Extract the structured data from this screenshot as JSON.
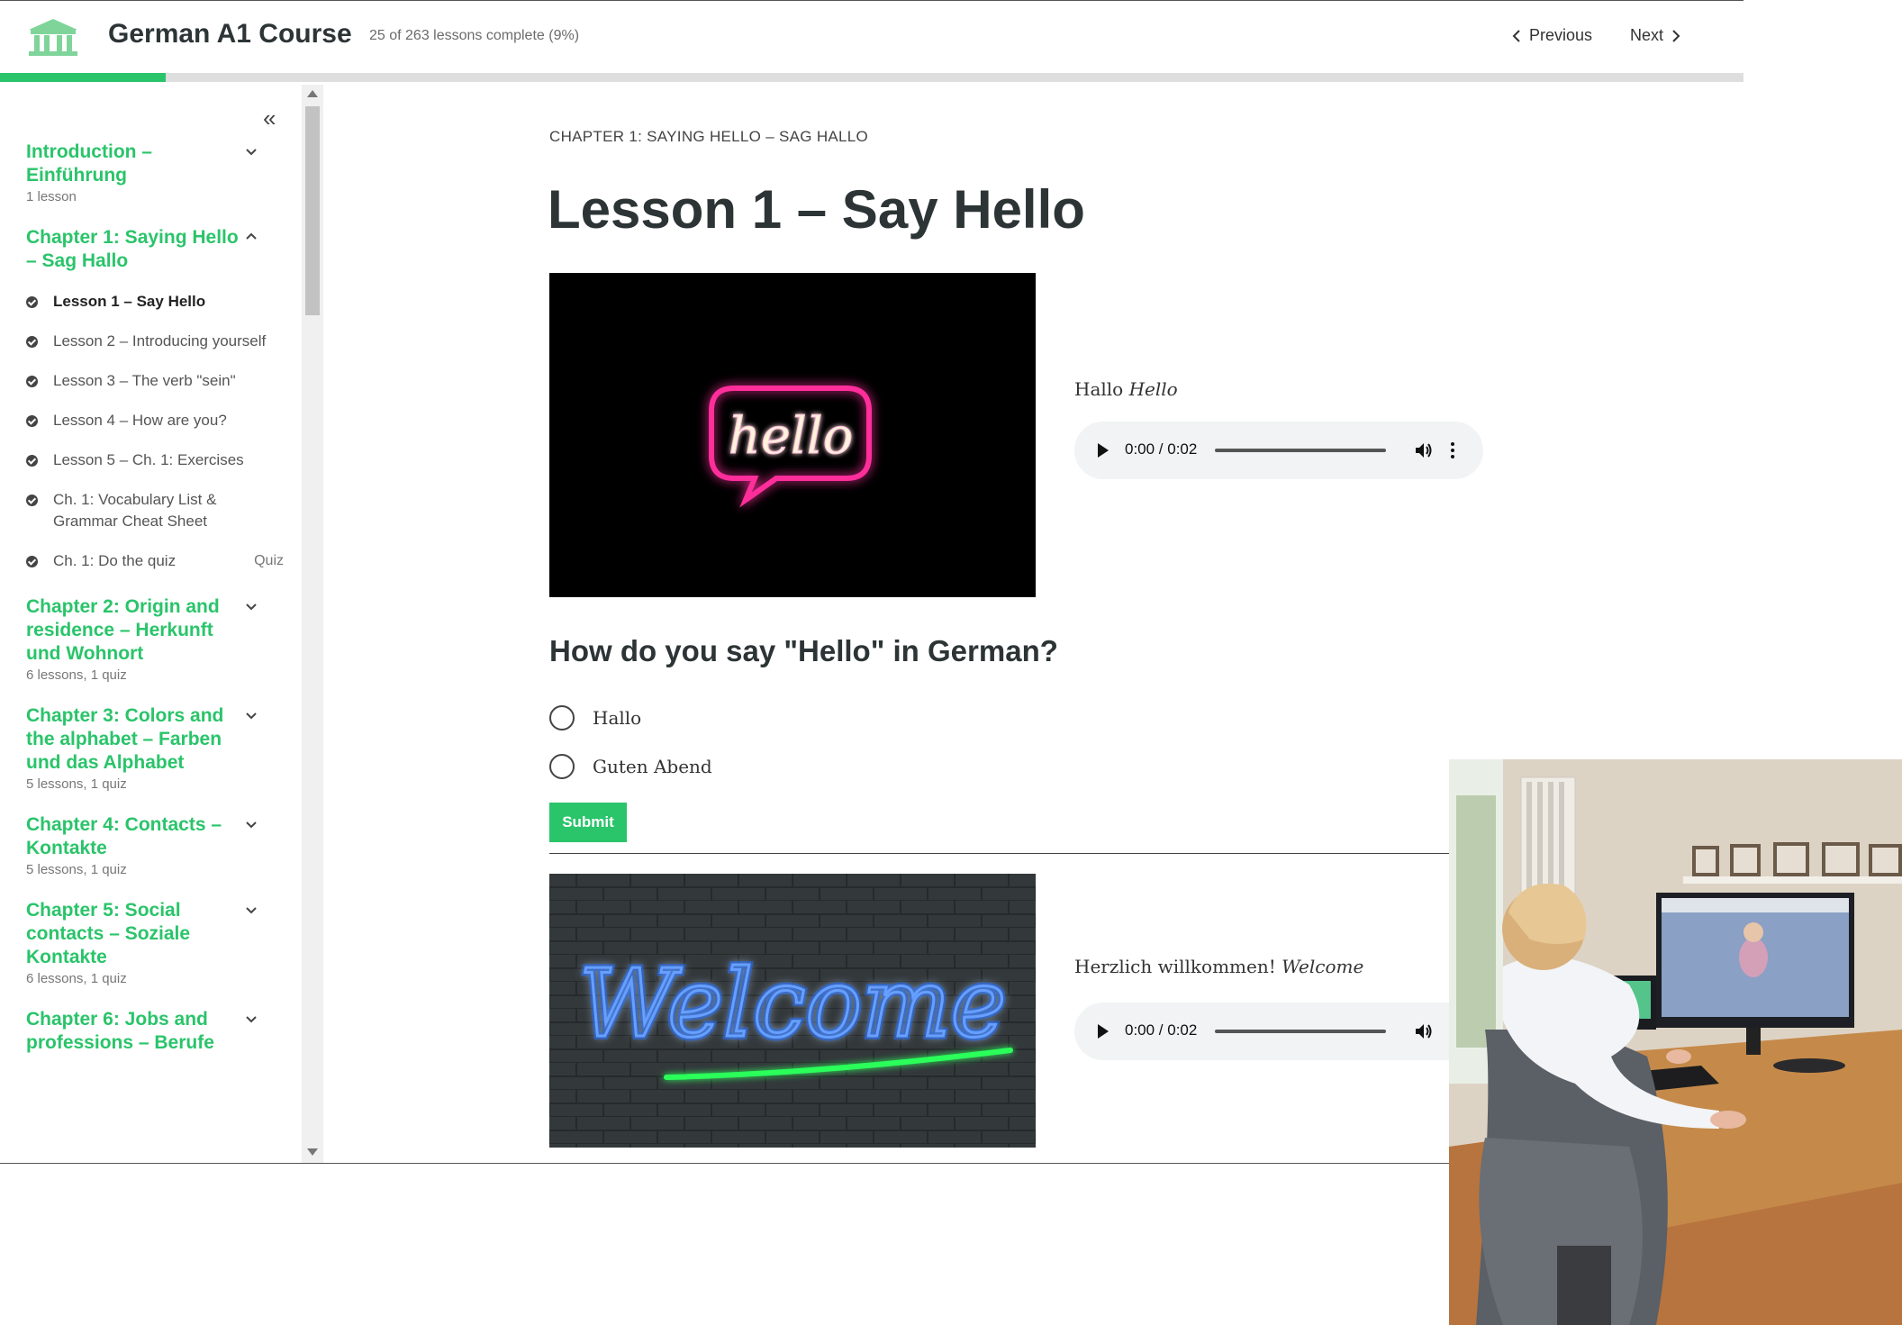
{
  "header": {
    "course_title": "German A1 Course",
    "progress_text": "25 of 263 lessons complete (9%)",
    "progress_fraction": 0.0951,
    "previous_label": "Previous",
    "next_label": "Next"
  },
  "sidebar": {
    "chapters": [
      {
        "title": "Introduction – Einführung",
        "meta": "1 lesson",
        "expanded": false
      },
      {
        "title": "Chapter 1: Saying Hello – Sag Hallo",
        "meta": "",
        "expanded": true,
        "lessons": [
          {
            "label": "Lesson 1 – Say Hello",
            "active": true
          },
          {
            "label": "Lesson 2 – Introducing yourself"
          },
          {
            "label": "Lesson 3 – The verb \"sein\""
          },
          {
            "label": "Lesson 4 – How are you?"
          },
          {
            "label": "Lesson 5 – Ch. 1: Exercises"
          },
          {
            "label": "Ch. 1: Vocabulary List & Grammar Cheat Sheet"
          },
          {
            "label": "Ch. 1: Do the quiz",
            "tag": "Quiz"
          }
        ]
      },
      {
        "title": "Chapter 2: Origin and residence – Herkunft und Wohnort",
        "meta": "6 lessons, 1 quiz",
        "expanded": false
      },
      {
        "title": "Chapter 3: Colors and the alphabet – Farben und das Alphabet",
        "meta": "5 lessons, 1 quiz",
        "expanded": false
      },
      {
        "title": "Chapter 4: Contacts – Kontakte",
        "meta": "5 lessons, 1 quiz",
        "expanded": false
      },
      {
        "title": "Chapter 5: Social contacts – Soziale Kontakte",
        "meta": "6 lessons, 1 quiz",
        "expanded": false
      },
      {
        "title": "Chapter 6: Jobs and professions – Berufe",
        "meta": "",
        "expanded": false
      }
    ]
  },
  "main": {
    "breadcrumb": "CHAPTER 1: SAYING HELLO – SAG HALLO",
    "title": "Lesson 1 – Say Hello",
    "audio1": {
      "german": "Hallo",
      "english": "Hello",
      "time": "0:00 / 0:02"
    },
    "hello_sign": "hello",
    "question": "How do you say \"Hello\" in German?",
    "options": [
      "Hallo",
      "Guten Abend"
    ],
    "submit_label": "Submit",
    "audio2": {
      "german": "Herzlich willkommen!",
      "english": "Welcome",
      "time": "0:00 / 0:02"
    },
    "welcome_sign": "Welcome"
  },
  "colors": {
    "accent": "#2ac46a",
    "heading": "#2d3436",
    "neon_pink": "#ff2d9b",
    "neon_blue": "#1f6bff",
    "neon_green": "#2cff5a"
  }
}
